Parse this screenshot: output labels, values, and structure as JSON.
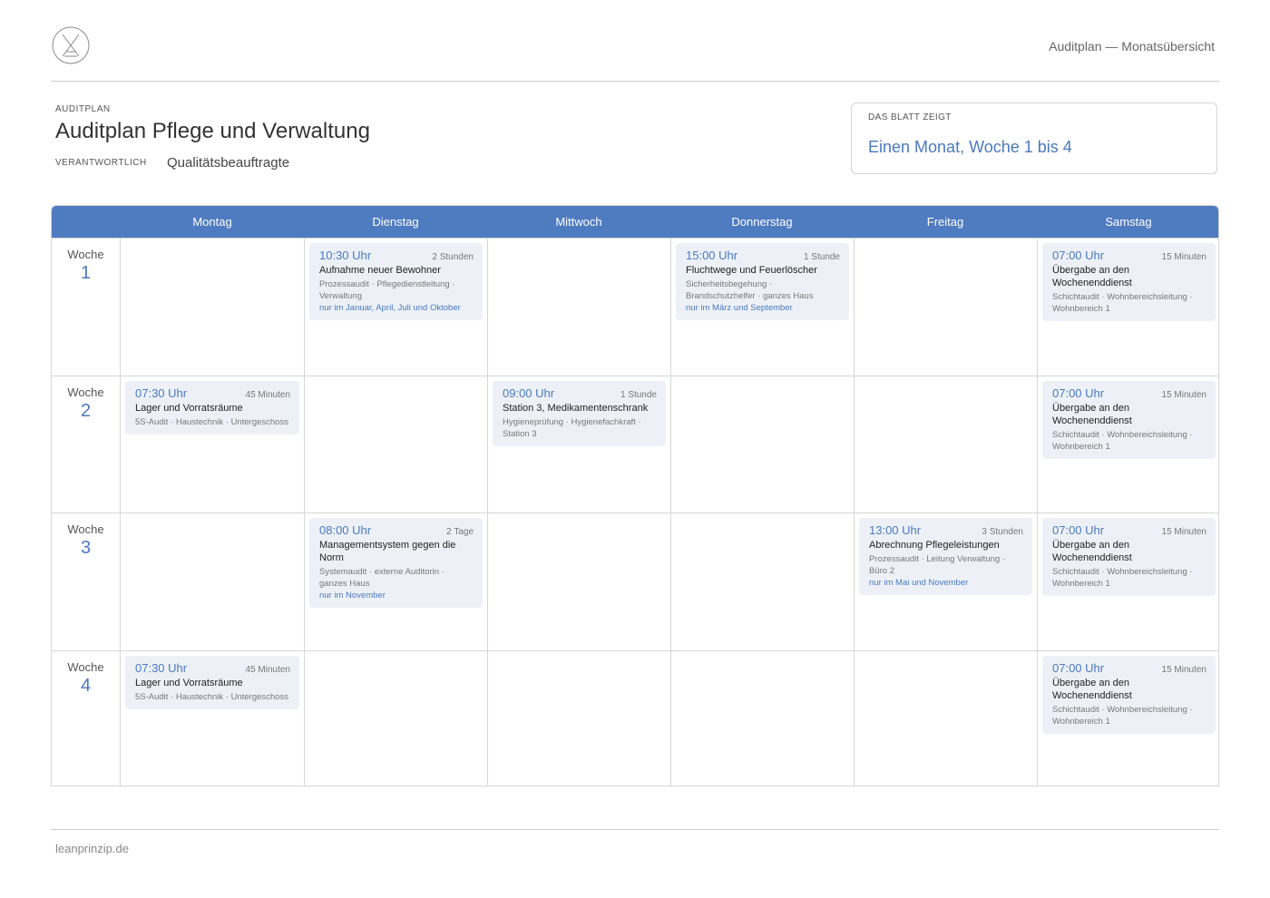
{
  "header": {
    "right_text": "Auditplan — Monatsübersicht"
  },
  "doc": {
    "eyebrow": "AUDITPLAN",
    "title": "Auditplan Pflege und Verwaltung",
    "responsible_label": "VERANTWORTLICH",
    "responsible_value": "Qualitätsbeauftragte"
  },
  "scope": {
    "label": "DAS BLATT ZEIGT",
    "value": "Einen Monat, Woche 1 bis 4"
  },
  "calendar": {
    "days": [
      "Montag",
      "Dienstag",
      "Mittwoch",
      "Donnerstag",
      "Freitag",
      "Samstag"
    ],
    "week_label": "Woche",
    "weeks": [
      {
        "number": "1",
        "cells": [
          null,
          {
            "time": "10:30 Uhr",
            "duration": "2 Stunden",
            "title": "Aufnahme neuer Bewohner",
            "meta": "Prozessaudit · Pflegedienstleitung · Verwaltung",
            "note": "nur im Januar, April, Juli und Oktober"
          },
          null,
          {
            "time": "15:00 Uhr",
            "duration": "1 Stunde",
            "title": "Fluchtwege und Feuerlöscher",
            "meta": "Sicherheitsbegehung · Brandschutzhelfer · ganzes Haus",
            "note": "nur im März und September"
          },
          null,
          {
            "time": "07:00 Uhr",
            "duration": "15 Minuten",
            "title": "Übergabe an den Wochenenddienst",
            "meta": "Schichtaudit · Wohnbereichsleitung · Wohnbereich 1",
            "note": ""
          }
        ]
      },
      {
        "number": "2",
        "cells": [
          {
            "time": "07:30 Uhr",
            "duration": "45 Minuten",
            "title": "Lager und Vorratsräume",
            "meta": "5S-Audit · Haustechnik · Untergeschoss",
            "note": ""
          },
          null,
          {
            "time": "09:00 Uhr",
            "duration": "1 Stunde",
            "title": "Station 3, Medikamentenschrank",
            "meta": "Hygieneprüfung · Hygienefachkraft · Station 3",
            "note": ""
          },
          null,
          null,
          {
            "time": "07:00 Uhr",
            "duration": "15 Minuten",
            "title": "Übergabe an den Wochenenddienst",
            "meta": "Schichtaudit · Wohnbereichsleitung · Wohnbereich 1",
            "note": ""
          }
        ]
      },
      {
        "number": "3",
        "cells": [
          null,
          {
            "time": "08:00 Uhr",
            "duration": "2 Tage",
            "title": "Managementsystem gegen die Norm",
            "meta": "Systemaudit · externe Auditorin · ganzes Haus",
            "note": "nur im November"
          },
          null,
          null,
          {
            "time": "13:00 Uhr",
            "duration": "3 Stunden",
            "title": "Abrechnung Pflegeleistungen",
            "meta": "Prozessaudit · Leitung Verwaltung · Büro 2",
            "note": "nur im Mai und November"
          },
          {
            "time": "07:00 Uhr",
            "duration": "15 Minuten",
            "title": "Übergabe an den Wochenenddienst",
            "meta": "Schichtaudit · Wohnbereichsleitung · Wohnbereich 1",
            "note": ""
          }
        ]
      },
      {
        "number": "4",
        "cells": [
          {
            "time": "07:30 Uhr",
            "duration": "45 Minuten",
            "title": "Lager und Vorratsräume",
            "meta": "5S-Audit · Haustechnik · Untergeschoss",
            "note": ""
          },
          null,
          null,
          null,
          null,
          {
            "time": "07:00 Uhr",
            "duration": "15 Minuten",
            "title": "Übergabe an den Wochenenddienst",
            "meta": "Schichtaudit · Wohnbereichsleitung · Wohnbereich 1",
            "note": ""
          }
        ]
      }
    ]
  },
  "footer": {
    "text": "leanprinzip.de"
  },
  "colors": {
    "accent": "#4a79c0",
    "header_band": "#4f7bc0",
    "card_bg": "#edf1f7"
  },
  "icons": {
    "logo": "hourglass-logo-icon"
  }
}
